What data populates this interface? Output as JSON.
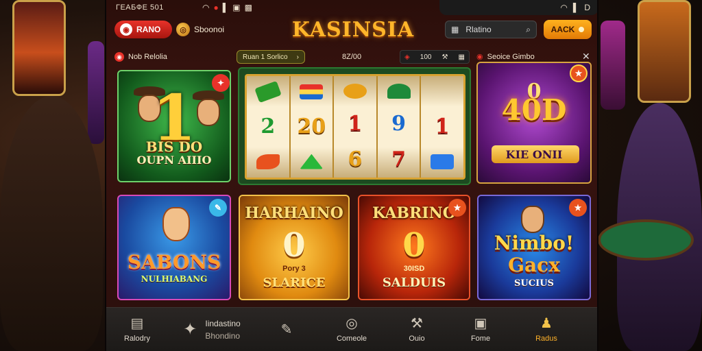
{
  "status_bar": {
    "left_text": "ГЕАБФЕ 501",
    "icons": [
      "wifi-icon",
      "record-icon",
      "signal-icon",
      "battery-icon",
      "lock-icon"
    ],
    "right_icons": [
      "wifi-icon",
      "signal-icon",
      "status-d-icon"
    ],
    "right_text": "D"
  },
  "header": {
    "brand_label": "RANO",
    "session_label": "Sboonoi",
    "logo_text": "KASINSIA",
    "search_value": "Rlatino",
    "back_label": "AACK"
  },
  "subbar": {
    "left_label": "Nob Relolia",
    "chip_label": "Ruan 1 Sorlico",
    "balance": "8Z/00",
    "bet_value": "100",
    "right_label": "Seoice Gimbo"
  },
  "games": {
    "g1": {
      "big": "1",
      "title": "BIS  DO",
      "sub": "OUPN AIIIO"
    },
    "g2": {
      "reels": [
        [
          "leaf",
          "2",
          "bird"
        ],
        [
          "flag",
          "20",
          "gem"
        ],
        [
          "coin",
          "1",
          "6"
        ],
        [
          "green",
          "9",
          "7"
        ],
        [
          "",
          "1",
          "blue"
        ]
      ]
    },
    "g3": {
      "zero": "0",
      "title": "40D",
      "sub": "KIE ONII"
    },
    "g4": {
      "title": "SABONS",
      "sub": "NULHIABANG"
    },
    "g5": {
      "title": "HARHAINO",
      "zero": "0",
      "mini": "Pory 3",
      "sub": "SLARICE"
    },
    "g6": {
      "title": "KABRINO",
      "zero": "0",
      "mini": "30ISD",
      "sub": "SALDUIS"
    },
    "g7": {
      "title": "Nimbo!",
      "title2": "Gacx",
      "sub": "SUCIUS"
    }
  },
  "bottom_nav": [
    {
      "label": "Ralodry",
      "icon": "list-icon",
      "active": false
    },
    {
      "label": "Iindastino",
      "label2": "Bhondino",
      "icon": "chip-icon",
      "active": false
    },
    {
      "label": "",
      "icon": "pen-icon",
      "active": false
    },
    {
      "label": "Comeole",
      "icon": "ball-icon",
      "active": false
    },
    {
      "label": "Ouio",
      "icon": "tools-icon",
      "active": false
    },
    {
      "label": "Fome",
      "icon": "screen-icon",
      "active": false
    },
    {
      "label": "Radus",
      "icon": "person-icon",
      "active": true
    }
  ],
  "colors": {
    "accent": "#ffb22a",
    "brand_red": "#e8322a",
    "back_orange": "#f29a12"
  }
}
